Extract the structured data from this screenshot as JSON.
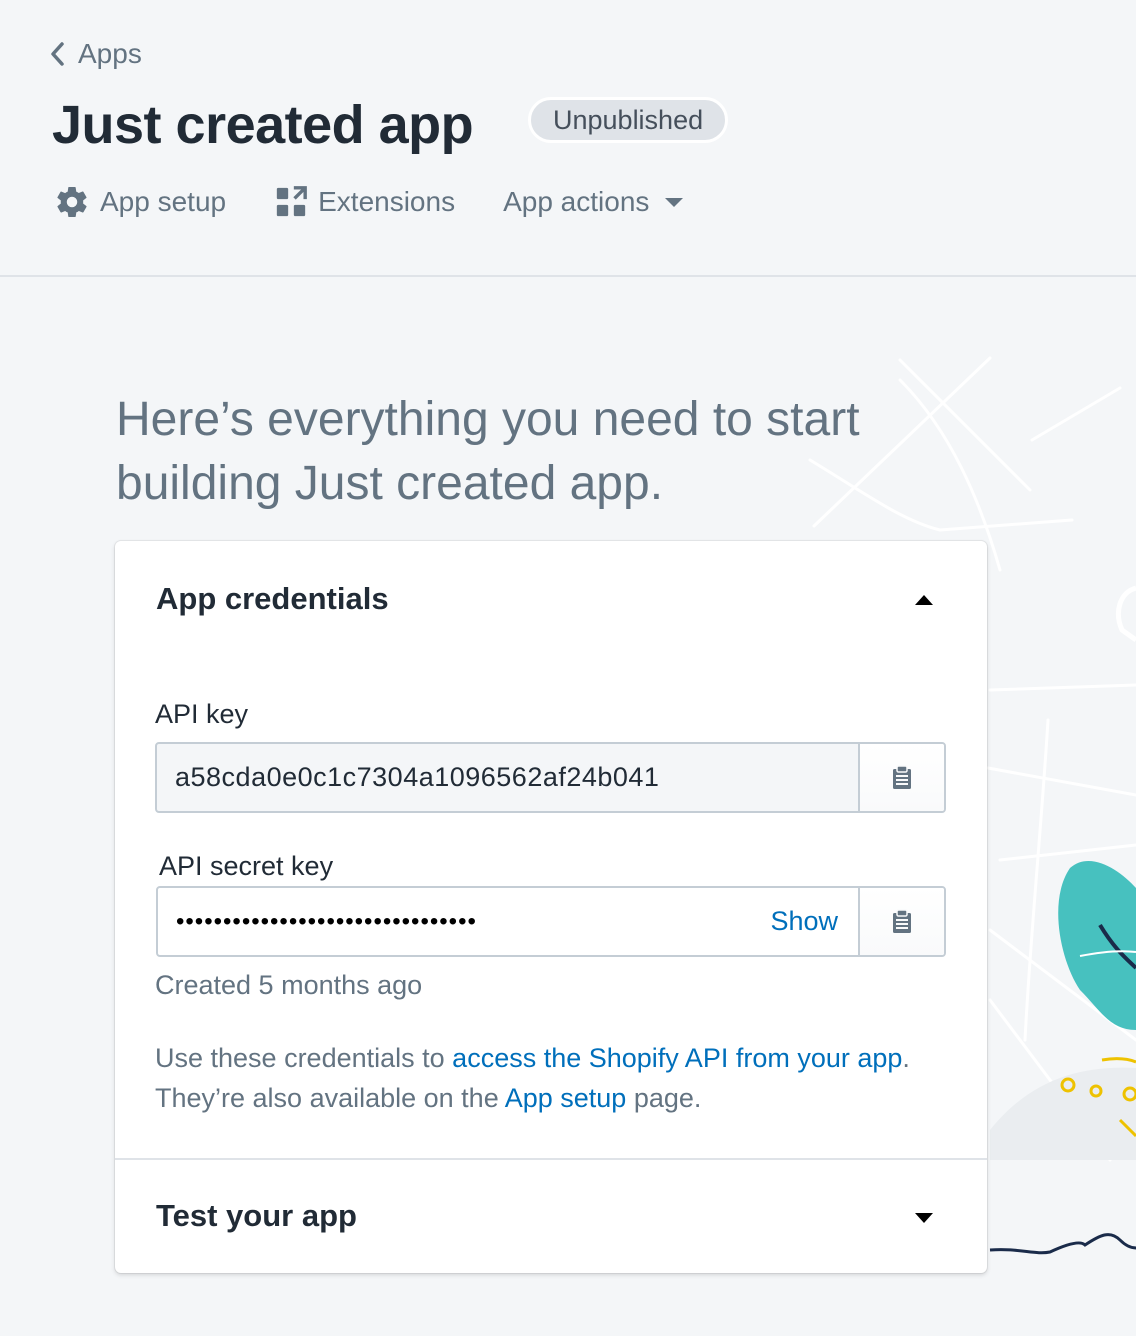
{
  "header": {
    "breadcrumb_label": "Apps",
    "title": "Just created app",
    "status_badge": "Unpublished",
    "actions": {
      "app_setup": "App setup",
      "extensions": "Extensions",
      "app_actions": "App actions"
    }
  },
  "intro": {
    "text": "Here’s everything you need to start building Just created app."
  },
  "credentials": {
    "heading": "App credentials",
    "api_key_label": "API key",
    "api_key_value": "a58cda0e0c1c7304a1096562af24b041",
    "api_secret_label": "API secret key",
    "api_secret_value": "••••••••••••••••••••••••••••••••",
    "show_label": "Show",
    "created_text": "Created 5 months ago",
    "desc_prefix": "Use these credentials to ",
    "desc_link1": "access the Shopify API from your app",
    "desc_middle": ". They’re also available on the ",
    "desc_link2": "App setup",
    "desc_suffix": " page."
  },
  "test": {
    "heading": "Test your app"
  },
  "colors": {
    "link": "#006fbb",
    "subdued_text": "#637381",
    "teal_leaf": "#47c1bf",
    "yellow_accent": "#eec200"
  },
  "icons": {
    "breadcrumb": "chevron-left-icon",
    "app_setup": "gear-icon",
    "extensions": "extensions-icon",
    "app_actions": "caret-down-icon",
    "copy": "clipboard-icon",
    "collapse": "caret-up-icon",
    "expand": "caret-down-icon"
  }
}
